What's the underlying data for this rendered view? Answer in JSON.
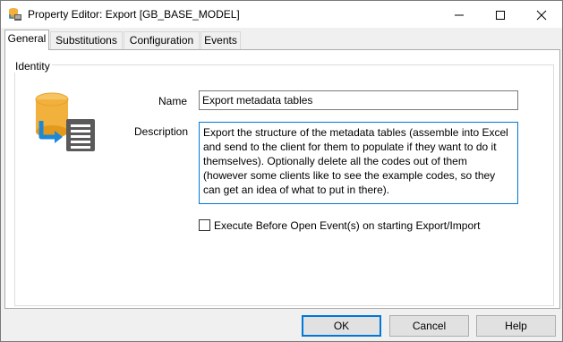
{
  "window": {
    "title": "Property Editor: Export [GB_BASE_MODEL]",
    "icon": "database-export-icon"
  },
  "tabs": [
    {
      "label": "General",
      "active": true
    },
    {
      "label": "Substitutions",
      "active": false
    },
    {
      "label": "Configuration",
      "active": false
    },
    {
      "label": "Events",
      "active": false
    }
  ],
  "identity": {
    "group_label": "Identity",
    "icon": "export-metadata-icon",
    "name_label": "Name",
    "name_value": "Export metadata tables",
    "description_label": "Description",
    "description_value": "Export the structure of the metadata tables (assemble into Excel and send to the client for them to populate if they want to do it themselves). Optionally delete all the codes out of them (however some clients like to see the example codes, so they can get an idea of what to put in there).",
    "execute_before_open_label": "Execute Before Open Event(s) on starting Export/Import",
    "execute_before_open_checked": false
  },
  "buttons": {
    "ok": "OK",
    "cancel": "Cancel",
    "help": "Help"
  },
  "colors": {
    "accent": "#0078d7",
    "database": "#f2b13d",
    "arrow": "#1e88d6",
    "document": "#5a5a5a"
  }
}
